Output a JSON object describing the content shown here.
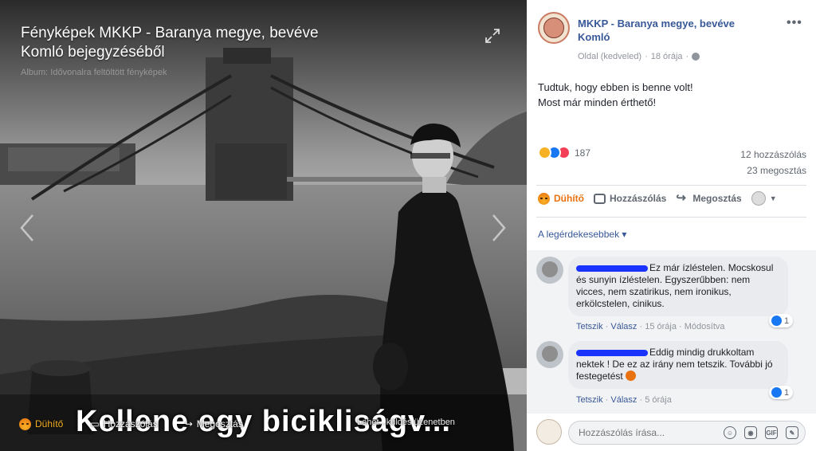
{
  "photo": {
    "title": "Fényképek MKKP - Baranya megye, bevéve Komló bejegyzéséből",
    "album": "Album: Idővonalra feltöltött fényképek",
    "caption": "Kellene egy bicikliságv...",
    "bar": {
      "angry_label": "Dühítő",
      "comment_label": "Hozzászólás",
      "share_label": "Megosztás",
      "send_label": "Lehet...küldés üzenetben"
    }
  },
  "post": {
    "page_name": "MKKP - Baranya megye, bevéve Komló",
    "meta_type": "Oldal (kedveled)",
    "meta_sep": "·",
    "meta_time": "18 órája",
    "meta_sep2": "·",
    "text_line1": "Tudtuk, hogy ebben is benne volt!",
    "text_line2": "Most már minden érthető!",
    "reaction_count": "187",
    "comments_count": "12 hozzászólás",
    "shares_count": "23 megosztás"
  },
  "actions": {
    "angry": "Dühítő",
    "comment": "Hozzászólás",
    "share": "Megosztás"
  },
  "filter": {
    "label": "A legérdekesebbek",
    "caret": "▾"
  },
  "comments": [
    {
      "text": "Ez már ízléstelen. Mocskosul és sunyin ízléstelen. Egyszerűbben: nem vicces, nem szatirikus, nem ironikus, erkölcstelen, cinikus.",
      "like": "Tetszik",
      "reply": "Válasz",
      "time": "15 órája",
      "edited": "Módosítva",
      "reactions": "1"
    },
    {
      "text": "Eddig mindig drukkoltam nektek ! De ez az irány nem tetszik. További jó festegetést",
      "like": "Tetszik",
      "reply": "Válasz",
      "time": "5 órája",
      "reactions": "1"
    }
  ],
  "composer": {
    "placeholder": "Hozzászólás írása...",
    "icons": [
      "emoji-icon",
      "camera-icon",
      "gif-icon",
      "sticker-icon"
    ]
  },
  "colors": {
    "link": "#385898",
    "angry": "#e9710f",
    "like": "#1877f2",
    "love": "#f33e58",
    "redaction": "#1a33ff"
  }
}
